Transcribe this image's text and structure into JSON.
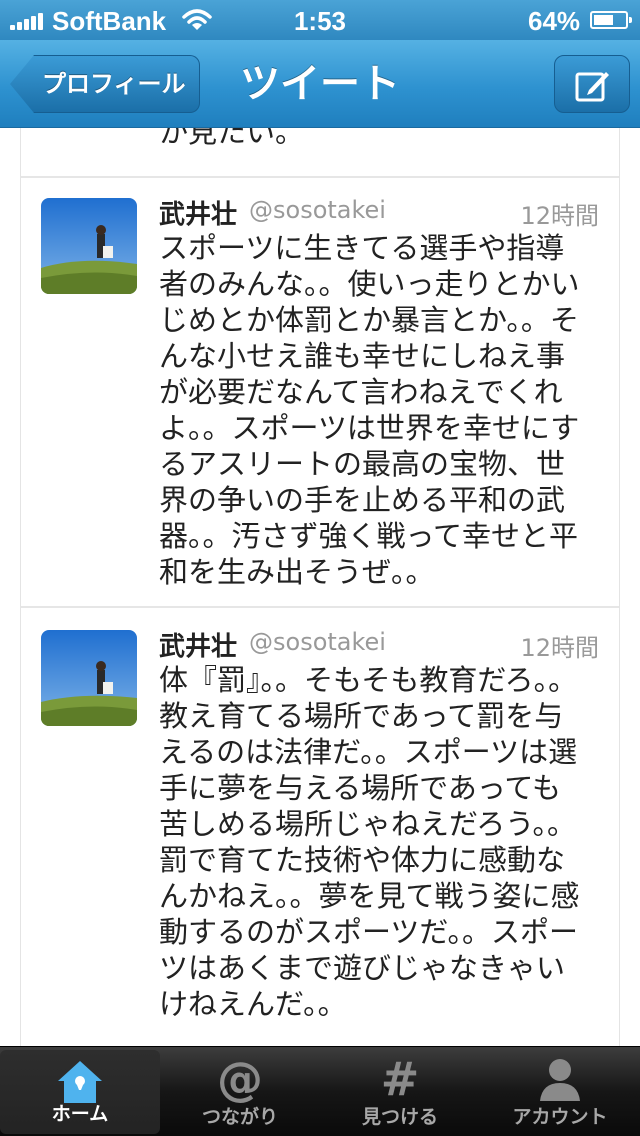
{
  "status_bar": {
    "carrier": "SoftBank",
    "time": "1:53",
    "battery_percent": "64%",
    "battery_level": 0.64
  },
  "nav": {
    "back_label": "プロフィール",
    "title": "ツイート",
    "compose_icon": "compose-icon"
  },
  "feed": {
    "previous_fragment": "か見たい。",
    "tweets": [
      {
        "name": "武井壮",
        "handle": "@sosotakei",
        "time": "12時間",
        "text": "スポーツに生きてる選手や指導者のみんな。。使いっ走りとかいじめとか体罰とか暴言とか。。そんな小せえ誰も幸せにしねえ事が必要だなんて言わねえでくれよ。。スポーツは世界を幸せにするアスリートの最高の宝物、世界の争いの手を止める平和の武器。。汚さず強く戦って幸せと平和を生み出そうぜ。。"
      },
      {
        "name": "武井壮",
        "handle": "@sosotakei",
        "time": "12時間",
        "text": "体『罰』。。そもそも教育だろ。。教え育てる場所であって罰を与えるのは法律だ。。スポーツは選手に夢を与える場所であっても苦しめる場所じゃねえだろう。。罰で育てた技術や体力に感動なんかねえ。。夢を見て戦う姿に感動するのがスポーツだ。。スポーツはあくまで遊びじゃなきゃいけねえんだ。。"
      }
    ]
  },
  "tab_bar": {
    "tabs": [
      {
        "label": "ホーム",
        "icon": "home-icon",
        "active": true
      },
      {
        "label": "つながり",
        "icon": "at-icon",
        "active": false
      },
      {
        "label": "見つける",
        "icon": "hash-icon",
        "active": false
      },
      {
        "label": "アカウント",
        "icon": "person-icon",
        "active": false
      }
    ]
  },
  "colors": {
    "nav_blue": "#2e92d0",
    "tab_active_icon": "#4fb3ee"
  }
}
